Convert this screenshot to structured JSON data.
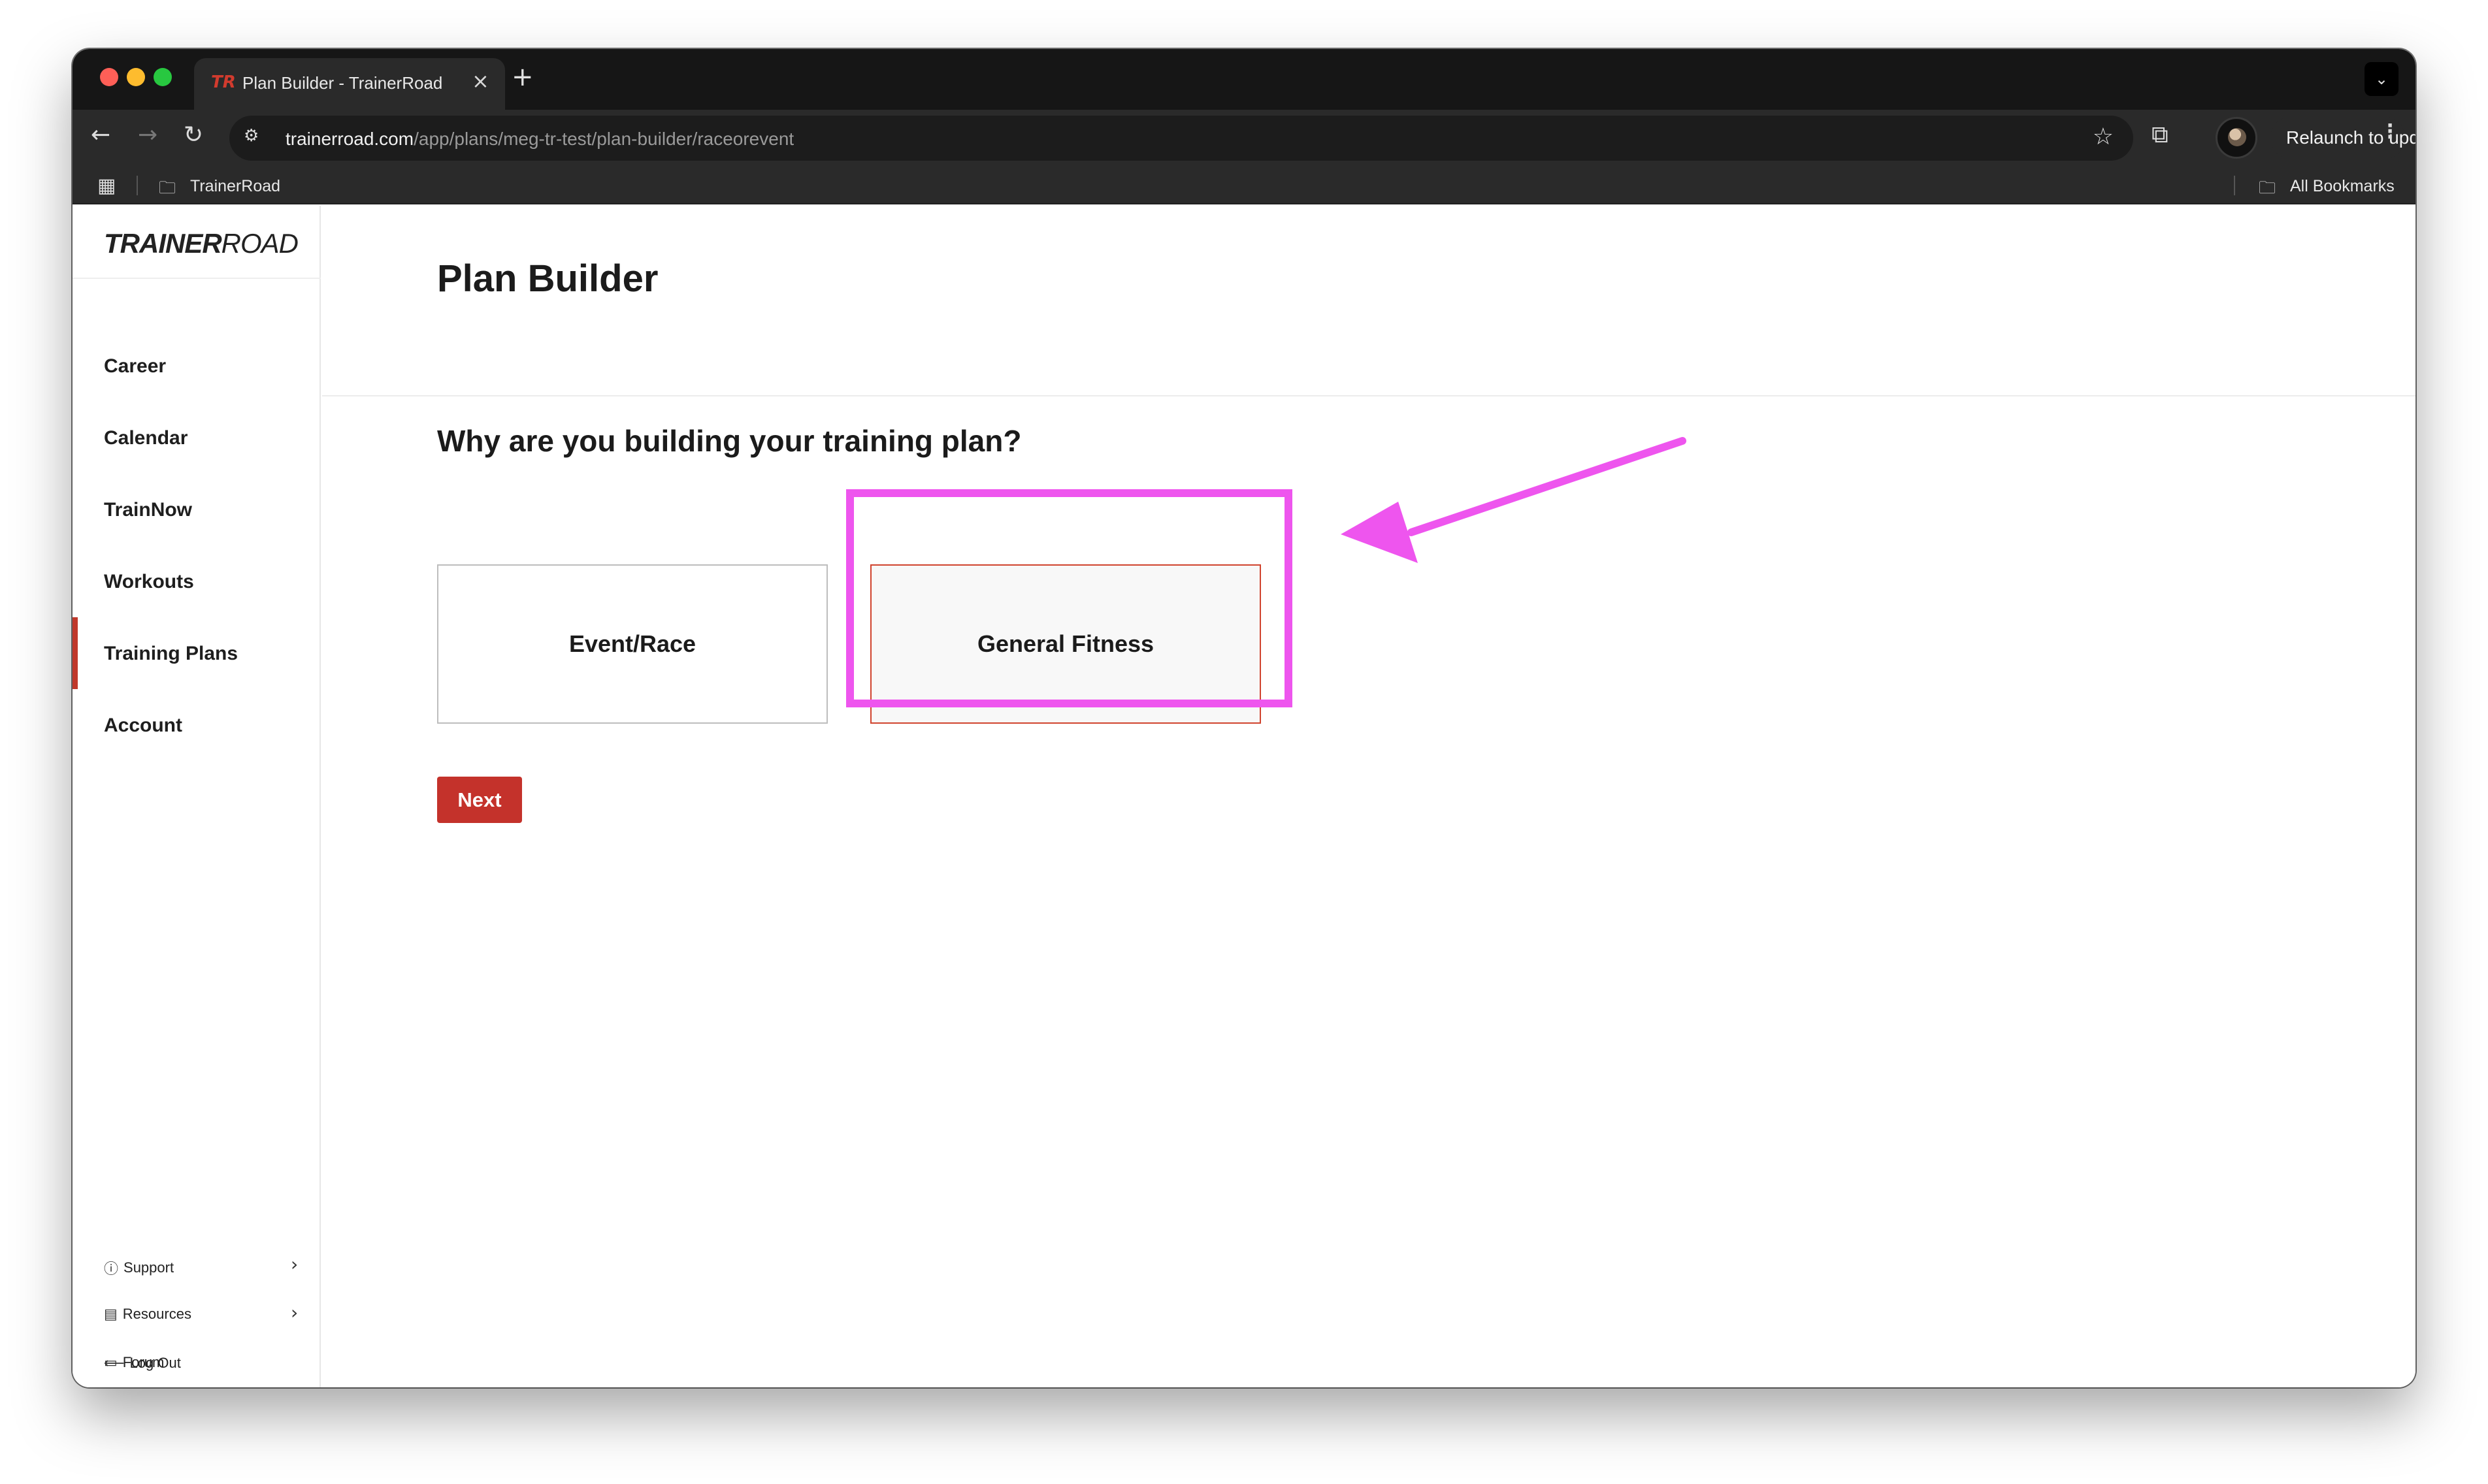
{
  "browser": {
    "tab_title": "Plan Builder - TrainerRoad",
    "tab_favicon": "TR",
    "url_host": "trainerroad.com",
    "url_path": "/app/plans/meg-tr-test/plan-builder/raceorevent",
    "relaunch_label": "Relaunch to update",
    "bookmark_folder": "TrainerRoad",
    "all_bookmarks": "All Bookmarks"
  },
  "sidebar": {
    "logo_train": "TRAINER",
    "logo_road": "ROAD",
    "items": [
      {
        "label": "Career"
      },
      {
        "label": "Calendar"
      },
      {
        "label": "TrainNow"
      },
      {
        "label": "Workouts"
      },
      {
        "label": "Training Plans"
      },
      {
        "label": "Account"
      }
    ],
    "active_item": "Training Plans",
    "footer": [
      {
        "label": "Support",
        "icon": "help-circle-icon"
      },
      {
        "label": "Resources",
        "icon": "newspaper-icon"
      },
      {
        "label": "Forum",
        "icon": "chat-bubble-icon"
      },
      {
        "label": "Log Out",
        "icon": "arrow-left-icon"
      }
    ]
  },
  "main": {
    "page_title": "Plan Builder",
    "question": "Why are you building your training plan?",
    "choices": [
      {
        "label": "Event/Race"
      },
      {
        "label": "General Fitness"
      }
    ],
    "selected_choice": "General Fitness",
    "next_label": "Next"
  },
  "annotation": {
    "color": "#ee55ee"
  },
  "colors": {
    "accent": "#c4322b",
    "selected_border": "#d0442e"
  }
}
